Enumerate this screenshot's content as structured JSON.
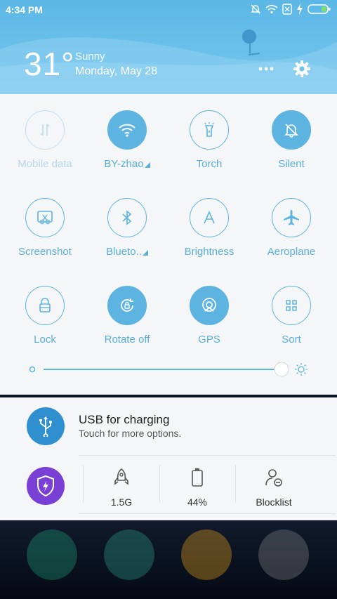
{
  "status_bar": {
    "time": "4:34 PM"
  },
  "weather": {
    "temperature": "31°",
    "condition": "Sunny",
    "date": "Monday, May 28"
  },
  "tiles": [
    {
      "label": "Mobile data",
      "icon": "mobile-data-icon",
      "state": "disabled"
    },
    {
      "label": "BY-zhao",
      "icon": "wifi-icon",
      "state": "on",
      "expand": true
    },
    {
      "label": "Torch",
      "icon": "torch-icon",
      "state": "off"
    },
    {
      "label": "Silent",
      "icon": "silent-bell-icon",
      "state": "on"
    },
    {
      "label": "Screenshot",
      "icon": "screenshot-icon",
      "state": "off"
    },
    {
      "label": "Blueto..",
      "icon": "bluetooth-icon",
      "state": "off",
      "expand": true
    },
    {
      "label": "Brightness",
      "icon": "brightness-auto-icon",
      "state": "off"
    },
    {
      "label": "Aeroplane",
      "icon": "airplane-icon",
      "state": "off"
    },
    {
      "label": "Lock",
      "icon": "lock-icon",
      "state": "off"
    },
    {
      "label": "Rotate off",
      "icon": "rotate-lock-icon",
      "state": "on"
    },
    {
      "label": "GPS",
      "icon": "gps-icon",
      "state": "on"
    },
    {
      "label": "Sort",
      "icon": "sort-grid-icon",
      "state": "off"
    }
  ],
  "brightness_level": 0.98,
  "notification": {
    "title": "USB for charging",
    "subtitle": "Touch for more options."
  },
  "security_stats": [
    {
      "value": "1.5G",
      "icon": "rocket-icon"
    },
    {
      "value": "44%",
      "icon": "battery-icon"
    },
    {
      "value": "Blocklist",
      "icon": "blocklist-user-icon"
    }
  ],
  "colors": {
    "accent": "#5db4e0",
    "header": "#6cc1ea",
    "shield": "#7a3fd4"
  }
}
